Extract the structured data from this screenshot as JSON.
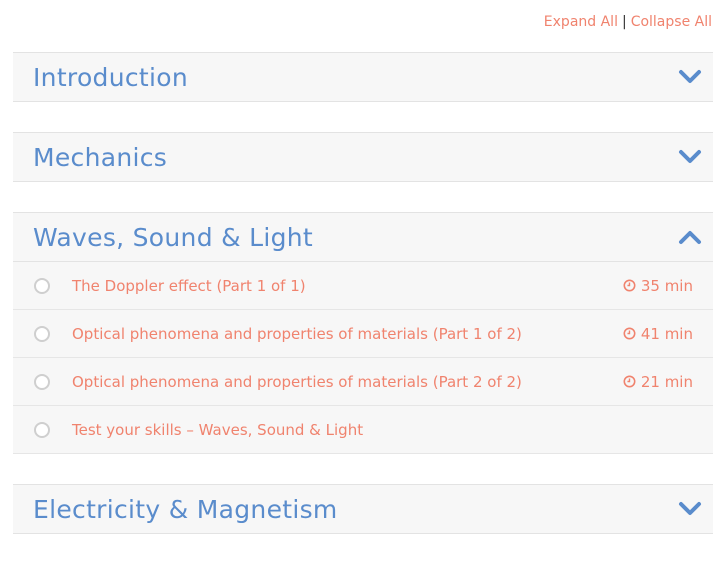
{
  "toplinks": {
    "expand_all": "Expand All",
    "separator": "|",
    "collapse_all": "Collapse All"
  },
  "sections": [
    {
      "title": "Introduction",
      "state": "collapsed",
      "chevron": "chevron-down-icon"
    },
    {
      "title": "Mechanics",
      "state": "collapsed",
      "chevron": "chevron-down-icon"
    },
    {
      "title": "Waves, Sound & Light",
      "state": "expanded",
      "chevron": "chevron-up-icon",
      "items": [
        {
          "title": "The Doppler effect (Part 1 of 1)",
          "duration": "35 min"
        },
        {
          "title": "Optical phenomena and properties of materials (Part 1 of 2)",
          "duration": "41 min"
        },
        {
          "title": "Optical phenomena and properties of materials (Part 2 of 2)",
          "duration": "21 min"
        },
        {
          "title": "Test your skills – Waves, Sound & Light",
          "duration": ""
        }
      ]
    },
    {
      "title": "Electricity & Magnetism",
      "state": "collapsed",
      "chevron": "chevron-down-icon"
    }
  ],
  "colors": {
    "title_blue": "#5a8ccc",
    "link_orange": "#f0836e",
    "header_bg": "#f7f7f7"
  }
}
